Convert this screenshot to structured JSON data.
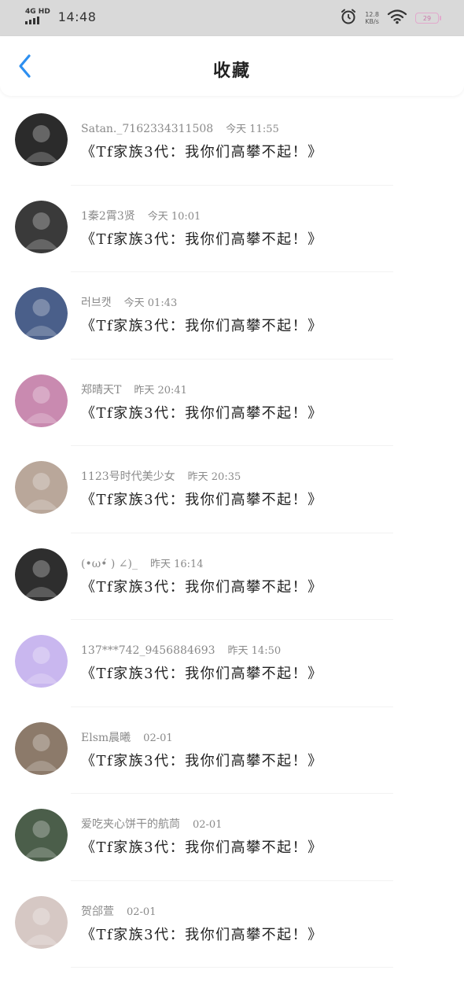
{
  "status_bar": {
    "network": "4G HD",
    "time": "14:48",
    "speed_value": "12.8",
    "speed_unit": "KB/s",
    "battery": "29"
  },
  "header": {
    "title": "收藏"
  },
  "items": [
    {
      "username": "Satan._7162334311508",
      "time": "今天 11:55",
      "content": "《Tf家族3代：我你们高攀不起！》",
      "avatar_color": "#2b2b2b"
    },
    {
      "username": "1秦2霄3贤",
      "time": "今天 10:01",
      "content": "《Tf家族3代：我你们高攀不起！》",
      "avatar_color": "#3a3a3a"
    },
    {
      "username": "러브캣",
      "time": "今天 01:43",
      "content": "《Tf家族3代：我你们高攀不起！》",
      "avatar_color": "#4a5f8a"
    },
    {
      "username": "郑晴天T",
      "time": "昨天 20:41",
      "content": "《Tf家族3代：我你们高攀不起！》",
      "avatar_color": "#c98ab0"
    },
    {
      "username": "1123号时代美少女",
      "time": "昨天 20:35",
      "content": "《Tf家族3代：我你们高攀不起！》",
      "avatar_color": "#b9a79a"
    },
    {
      "username": "(•ω•́ ) ∠)_",
      "time": "昨天 16:14",
      "content": "《Tf家族3代：我你们高攀不起！》",
      "avatar_color": "#2e2e2e"
    },
    {
      "username": "137***742_9456884693",
      "time": "昨天 14:50",
      "content": "《Tf家族3代：我你们高攀不起！》",
      "avatar_color": "#c9b7ef"
    },
    {
      "username": "Elsm晨曦",
      "time": "02-01",
      "content": "《Tf家族3代：我你们高攀不起！》",
      "avatar_color": "#8c7a6a"
    },
    {
      "username": "爱吃夹心饼干的航茼",
      "time": "02-01",
      "content": "《Tf家族3代：我你们高攀不起！》",
      "avatar_color": "#4b5e4a"
    },
    {
      "username": "贺郃萱",
      "time": "02-01",
      "content": "《Tf家族3代：我你们高攀不起！》",
      "avatar_color": "#d6c8c4"
    }
  ]
}
